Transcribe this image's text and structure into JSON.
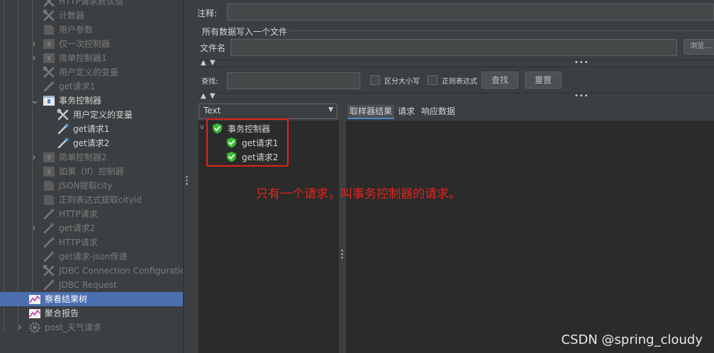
{
  "tree": {
    "items": [
      {
        "label": "HTTP请求默认值",
        "icon": "wrench-icon",
        "state": "disabled",
        "arrow": ""
      },
      {
        "label": "计数器",
        "icon": "wrench-icon",
        "state": "disabled",
        "arrow": ""
      },
      {
        "label": "用户参数",
        "icon": "preprocessor-icon",
        "state": "disabled",
        "arrow": ""
      },
      {
        "label": "仅一次控制器",
        "icon": "controller-icon",
        "state": "disabled",
        "arrow": ">"
      },
      {
        "label": "简单控制器1",
        "icon": "controller-icon",
        "state": "disabled",
        "arrow": ">"
      },
      {
        "label": "用户定义的变量",
        "icon": "wrench-icon",
        "state": "disabled",
        "arrow": ""
      },
      {
        "label": "get请求1",
        "icon": "pipette-icon",
        "state": "disabled",
        "arrow": ""
      },
      {
        "label": "事务控制器",
        "icon": "transaction-controller-icon",
        "state": "enabled",
        "arrow": "v"
      },
      {
        "label": "用户定义的变量",
        "icon": "wrench-icon",
        "state": "enabled",
        "arrow": ""
      },
      {
        "label": "get请求1",
        "icon": "pipette-icon",
        "state": "enabled",
        "arrow": ""
      },
      {
        "label": "get请求2",
        "icon": "pipette-icon",
        "state": "enabled",
        "arrow": ""
      },
      {
        "label": "简单控制器2",
        "icon": "controller-icon",
        "state": "disabled",
        "arrow": ">"
      },
      {
        "label": "如果（If）控制器",
        "icon": "controller-icon",
        "state": "disabled",
        "arrow": ""
      },
      {
        "label": "JSON提取city",
        "icon": "postprocessor-icon",
        "state": "disabled",
        "arrow": ""
      },
      {
        "label": "正则表达式提取cityid",
        "icon": "postprocessor-icon",
        "state": "disabled",
        "arrow": ""
      },
      {
        "label": "HTTP请求",
        "icon": "pipette-icon",
        "state": "disabled",
        "arrow": ""
      },
      {
        "label": "get请求2",
        "icon": "pipette-icon",
        "state": "disabled",
        "arrow": ">"
      },
      {
        "label": "HTTP请求",
        "icon": "pipette-icon",
        "state": "disabled",
        "arrow": ""
      },
      {
        "label": "get请求-json传递",
        "icon": "pipette-icon",
        "state": "disabled",
        "arrow": ""
      },
      {
        "label": "JDBC Connection Configuration",
        "icon": "wrench-icon",
        "state": "disabled",
        "arrow": ""
      },
      {
        "label": "JDBC Request",
        "icon": "pipette-icon",
        "state": "disabled",
        "arrow": ""
      },
      {
        "label": "察看结果树",
        "icon": "listener-icon",
        "state": "selected",
        "arrow": ""
      },
      {
        "label": "聚合报告",
        "icon": "listener-icon",
        "state": "enabled",
        "arrow": ""
      },
      {
        "label": "post_天气请求",
        "icon": "gear-icon",
        "state": "disabled",
        "arrow": ">"
      }
    ]
  },
  "form": {
    "comment_label": "注释:",
    "comment_value": "",
    "section_title": "所有数据写入一个文件",
    "filename_label": "文件名",
    "filename_value": "",
    "browse_label": "浏览..."
  },
  "search": {
    "label": "查找:",
    "value": "",
    "case_label": "区分大小写",
    "regex_label": "正则表达式",
    "find_button": "查找",
    "reset_button": "重置"
  },
  "results": {
    "render_select": "Text",
    "tree": [
      {
        "label": "事务控制器",
        "status": "success"
      },
      {
        "label": "get请求1",
        "status": "success"
      },
      {
        "label": "get请求2",
        "status": "success"
      }
    ],
    "tabs": [
      "取样器结果",
      "请求",
      "响应数据"
    ]
  },
  "annotation": "只有一个请求，叫事务控制器的请求。",
  "watermark": "CSDN @spring_cloudy",
  "colors": {
    "background": "#3c3f41",
    "panel": "#2b2b2b",
    "selection": "#4b6eaf",
    "annotation_red": "#e2231a",
    "success_green": "#3dbb3a"
  }
}
